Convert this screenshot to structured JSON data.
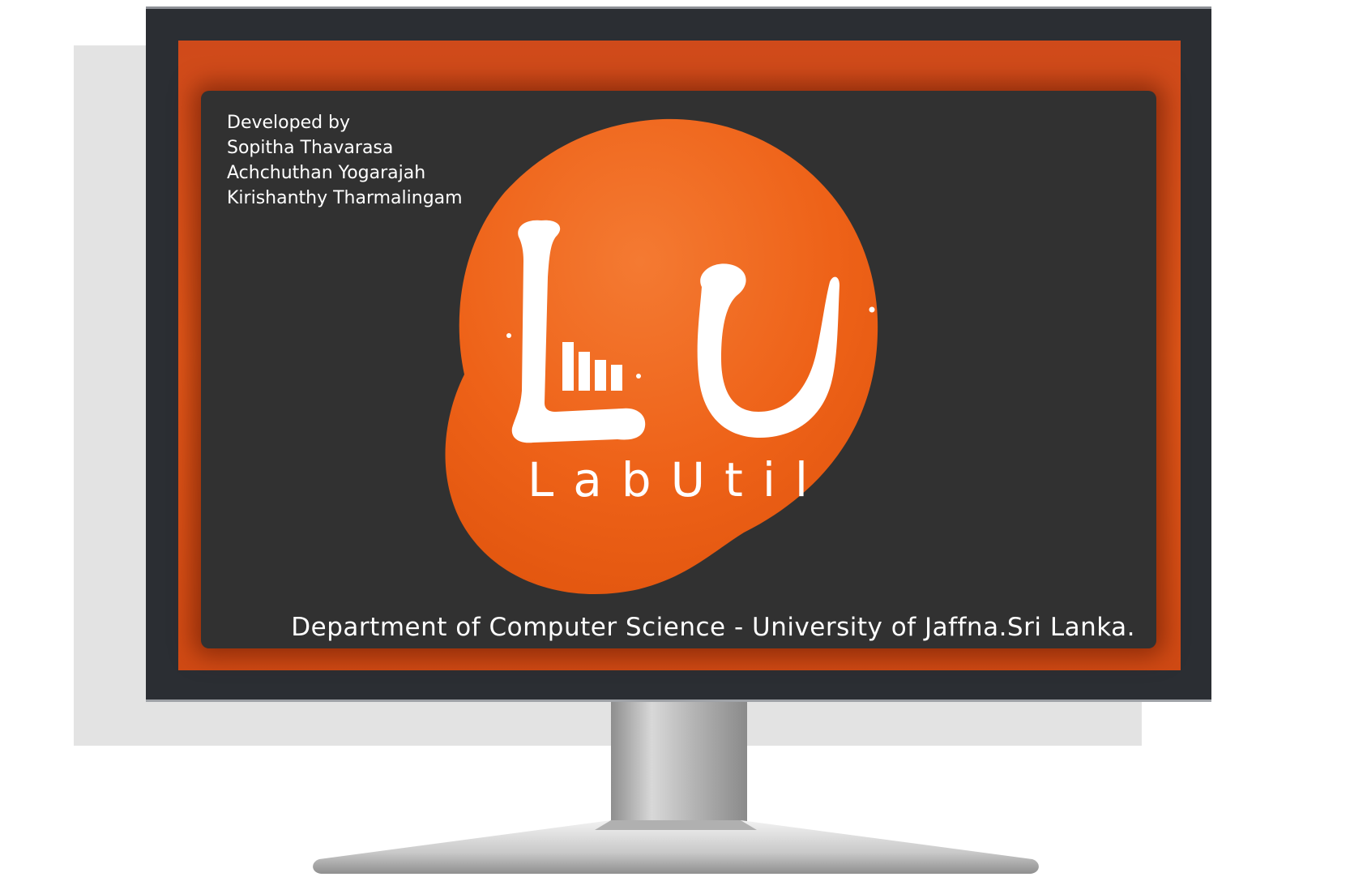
{
  "credits": {
    "heading": "Developed by",
    "developers": [
      "Sopitha Thavarasa",
      "Achchuthan Yogarajah",
      "Kirishanthy Tharmalingam"
    ]
  },
  "logo": {
    "monogram_l": "L",
    "monogram_u": "U",
    "name": "LabUtil"
  },
  "footer": {
    "organization": "Department of Computer Science - University of Jaffna.Sri Lanka."
  },
  "colors": {
    "accent": "#e85f1c",
    "panel": "#313131",
    "bezel": "#2b2e33"
  }
}
